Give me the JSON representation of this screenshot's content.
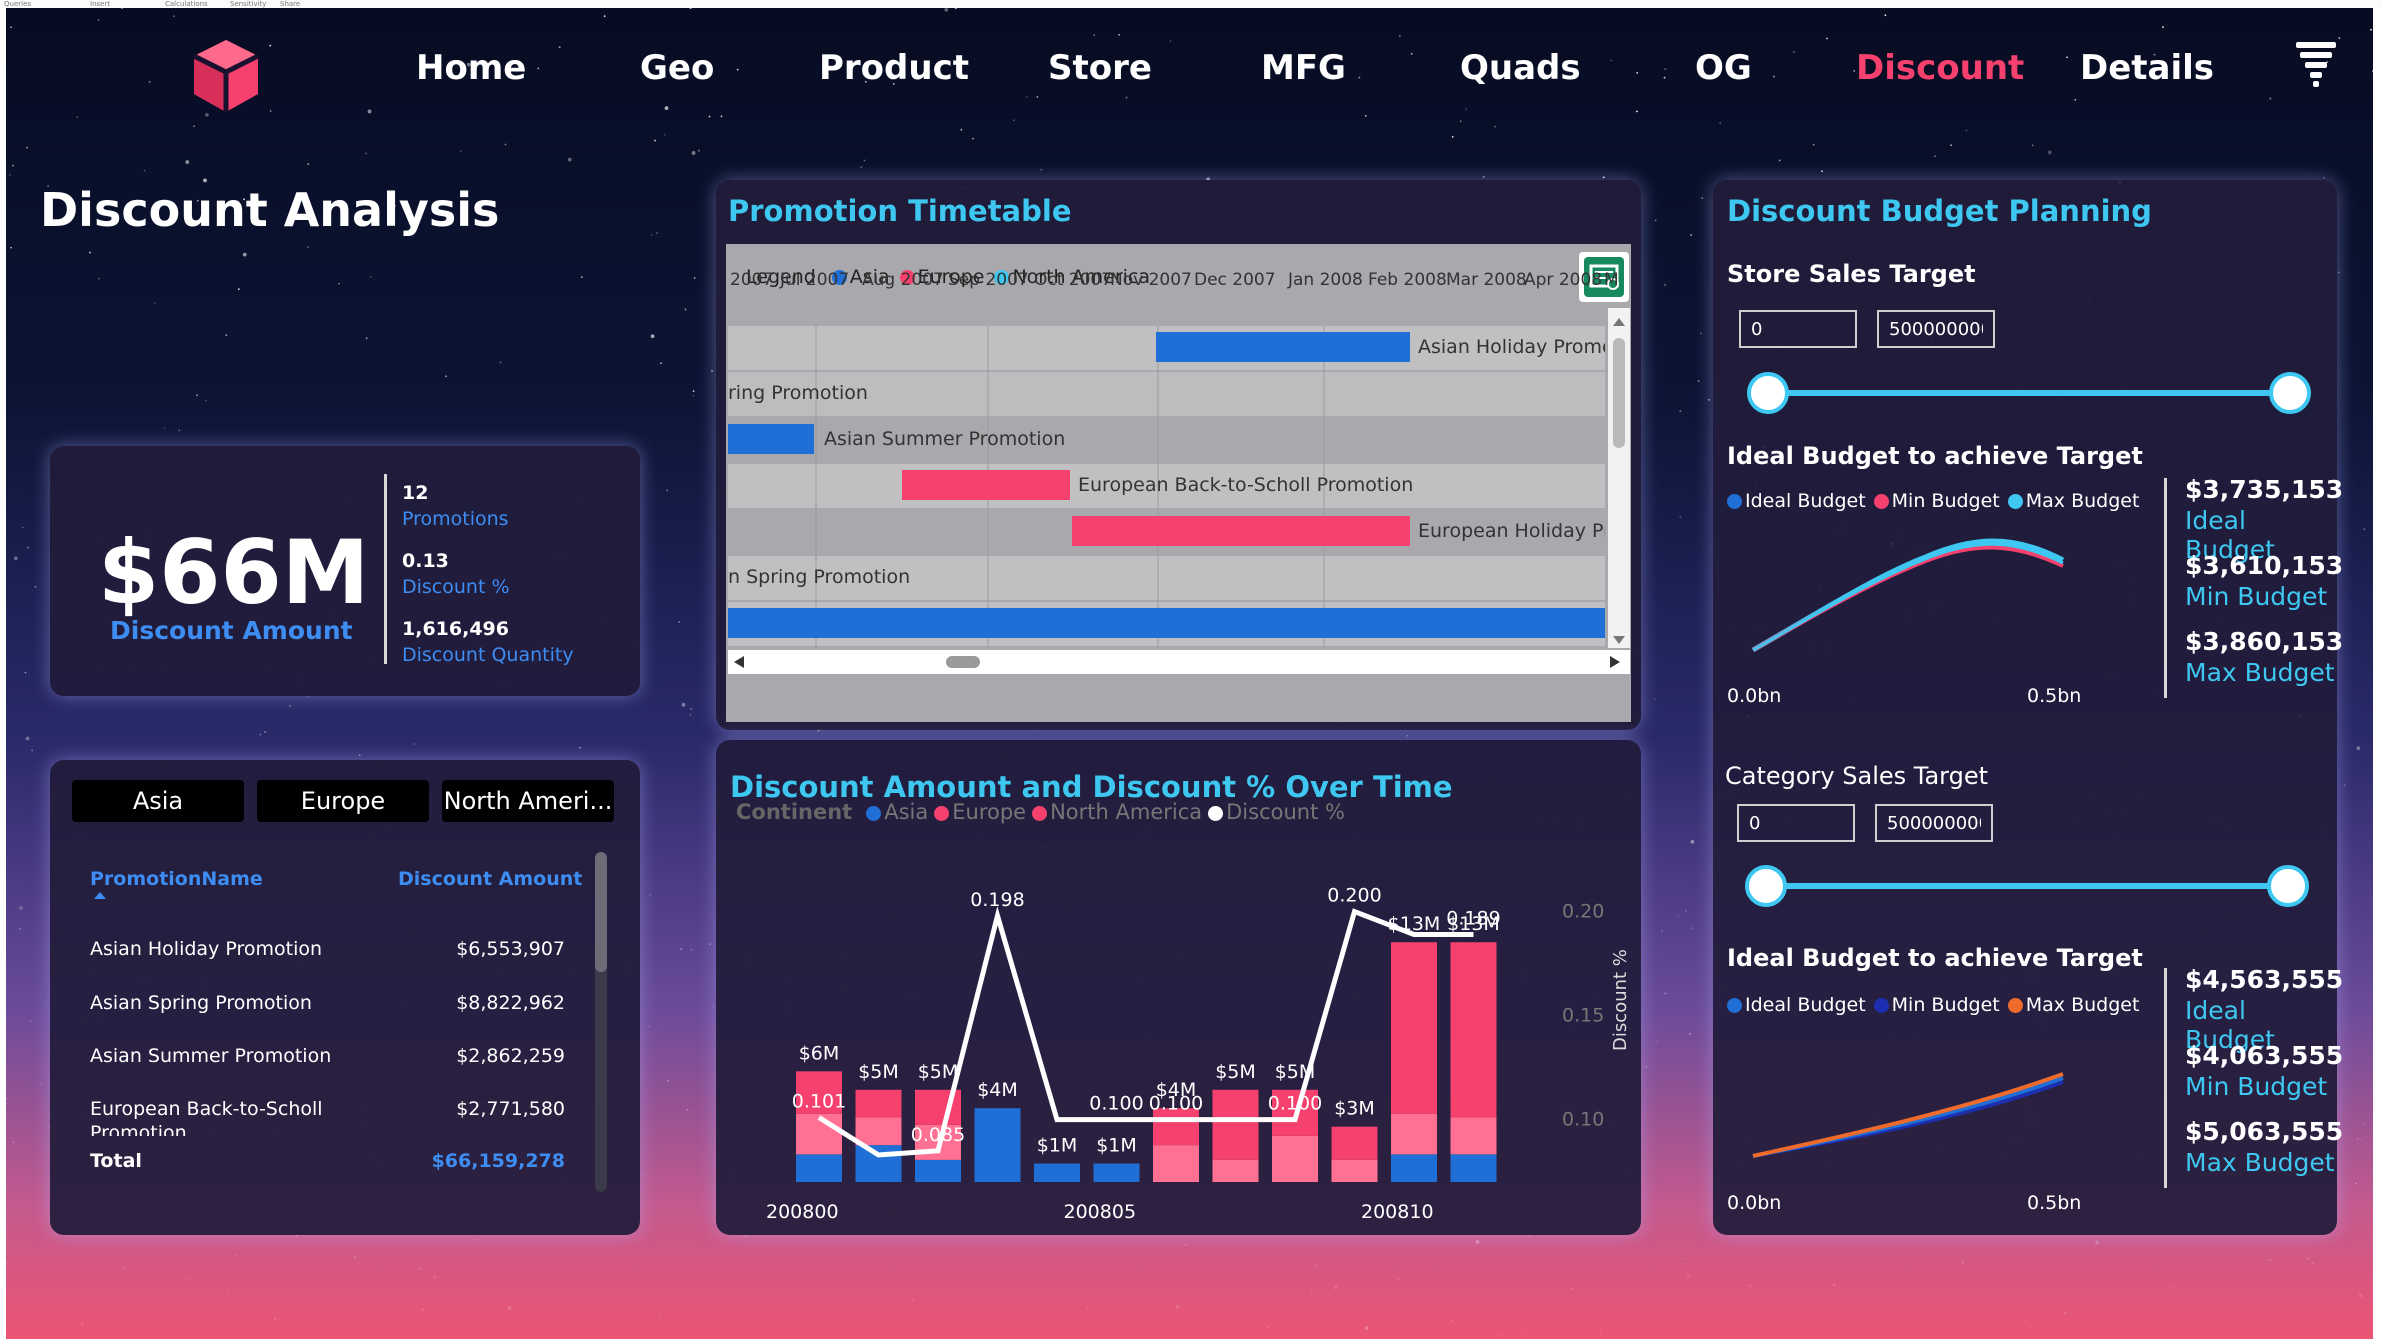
{
  "ribbon": {
    "a": "Queries",
    "b": "Insert",
    "c": "Calculations",
    "d": "Sensitivity",
    "e": "Share"
  },
  "nav": {
    "items": [
      "Home",
      "Geo",
      "Product",
      "Store",
      "MFG",
      "Quads",
      "OG",
      "Discount",
      "Details"
    ],
    "active": "Discount"
  },
  "page_title": "Discount Analysis",
  "kpi": {
    "amount": "$66M",
    "amount_label": "Discount Amount",
    "promotions_value": "12",
    "promotions_label": "Promotions",
    "discount_pct_value": "0.13",
    "discount_pct_label": "Discount %",
    "quantity_value": "1,616,496",
    "quantity_label": "Discount Quantity"
  },
  "slicer": [
    "Asia",
    "Europe",
    "North Ameri..."
  ],
  "table": {
    "col1": "PromotionName",
    "col2": "Discount Amount",
    "rows": [
      {
        "name": "Asian Holiday Promotion",
        "amount": "$6,553,907"
      },
      {
        "name": "Asian Spring Promotion",
        "amount": "$8,822,962"
      },
      {
        "name": "Asian Summer Promotion",
        "amount": "$2,862,259"
      },
      {
        "name": "European Back-to-Scholl",
        "name2": "Promotion",
        "amount": "$2,771,580"
      }
    ],
    "total_label": "Total",
    "total_value": "$66,159,278"
  },
  "timetable": {
    "title": "Promotion Timetable",
    "legend_title": "Legend",
    "legend": [
      {
        "name": "Asia",
        "color": "#1f6fd6"
      },
      {
        "name": "Europe",
        "color": "#f6416e"
      },
      {
        "name": "North America",
        "color": "#3ec7f0"
      }
    ],
    "months": [
      "2007",
      "Jul 2007",
      "Aug 2007",
      "Sep 2007",
      "Oct 2007",
      "Nov 2007",
      "Dec 2007",
      "Jan 2008",
      "Feb 2008",
      "Mar 2008",
      "Apr 2008",
      "M"
    ],
    "rows": [
      {
        "label": "Asian Holiday Promo",
        "color": "#1f6fd6"
      },
      {
        "label": "ring Promotion",
        "color": ""
      },
      {
        "label": "Asian Summer Promotion",
        "color": "#1f6fd6"
      },
      {
        "label": "European Back-to-Scholl Promotion",
        "color": "#f6416e"
      },
      {
        "label": "European Holiday Pr",
        "color": "#f6416e"
      },
      {
        "label": "n Spring Promotion",
        "color": ""
      },
      {
        "label": "",
        "color": "#1f6fd6"
      }
    ]
  },
  "combo": {
    "title": "Discount Amount and Discount % Over Time",
    "legend_title": "Continent",
    "legend": [
      {
        "name": "Asia",
        "color": "#1f6fd6"
      },
      {
        "name": "Europe",
        "color": "#f6416e"
      },
      {
        "name": "North America",
        "color": "#f6416e"
      },
      {
        "name": "Discount %",
        "color": "#ffffff"
      }
    ],
    "y2_title": "Discount %"
  },
  "budget": {
    "title": "Discount Budget Planning",
    "store": {
      "heading": "Store Sales Target",
      "min_input": "0",
      "max_input": "500000000",
      "chart_heading": "Ideal Budget to achieve Target",
      "legend": [
        {
          "name": "Ideal Budget",
          "color": "#1f6fd6"
        },
        {
          "name": "Min Budget",
          "color": "#f6416e"
        },
        {
          "name": "Max Budget",
          "color": "#3ec7f0"
        }
      ],
      "x_left": "0.0bn",
      "x_right": "0.5bn",
      "values": [
        {
          "v": "$3,735,153",
          "l": "Ideal Budget"
        },
        {
          "v": "$3,610,153",
          "l": "Min Budget"
        },
        {
          "v": "$3,860,153",
          "l": "Max Budget"
        }
      ]
    },
    "category": {
      "heading": "Category Sales Target",
      "min_input": "0",
      "max_input": "500000000",
      "chart_heading": "Ideal Budget to achieve Target",
      "legend": [
        {
          "name": "Ideal Budget",
          "color": "#1f6fd6"
        },
        {
          "name": "Min Budget",
          "color": "#1b2fb0"
        },
        {
          "name": "Max Budget",
          "color": "#ef6b2c"
        }
      ],
      "x_left": "0.0bn",
      "x_right": "0.5bn",
      "values": [
        {
          "v": "$4,563,555",
          "l": "Ideal Budget"
        },
        {
          "v": "$4,063,555",
          "l": "Min Budget"
        },
        {
          "v": "$5,063,555",
          "l": "Max Budget"
        }
      ]
    }
  },
  "chart_data": {
    "type": "bar",
    "title": "Discount Amount and Discount % Over Time",
    "series_note": "",
    "x_ticks": [
      "200800",
      "200805",
      "200810"
    ],
    "y2_ticks": [
      "0.10",
      "0.15",
      "0.20"
    ],
    "y2lim": [
      0.07,
      0.22
    ],
    "ylim": [
      0,
      18
    ],
    "bars": [
      {
        "total_label": "$6M",
        "asia": 1.5,
        "europe": 2.2,
        "na": 2.3
      },
      {
        "total_label": "$5M",
        "asia": 2.0,
        "europe": 1.5,
        "na": 1.5
      },
      {
        "total_label": "$5M",
        "asia": 1.2,
        "europe": 1.9,
        "na": 1.9
      },
      {
        "total_label": "$4M",
        "asia": 4.0,
        "europe": 0,
        "na": 0
      },
      {
        "total_label": "$1M",
        "asia": 1.0,
        "europe": 0,
        "na": 0
      },
      {
        "total_label": "$1M",
        "asia": 1.0,
        "europe": 0,
        "na": 0
      },
      {
        "total_label": "$4M",
        "asia": 0,
        "europe": 2.0,
        "na": 2.0
      },
      {
        "total_label": "$5M",
        "asia": 0,
        "europe": 1.2,
        "na": 3.8
      },
      {
        "total_label": "$5M",
        "asia": 0,
        "europe": 2.5,
        "na": 2.5
      },
      {
        "total_label": "$3M",
        "asia": 0,
        "europe": 1.2,
        "na": 1.8
      },
      {
        "total_label": "$13M",
        "asia": 1.5,
        "europe": 2.2,
        "na": 9.3
      },
      {
        "total_label": "$13M",
        "asia": 1.5,
        "europe": 2.0,
        "na": 9.5
      }
    ],
    "line": [
      0.101,
      0.083,
      0.085,
      0.198,
      0.1,
      0.1,
      0.1,
      0.1,
      0.1,
      0.2,
      0.189,
      0.189
    ],
    "line_labels": [
      {
        "i": 0,
        "text": "0.101"
      },
      {
        "i": 2,
        "text": "0.085"
      },
      {
        "i": 3,
        "text": "0.198"
      },
      {
        "i": 5,
        "text": "0.100"
      },
      {
        "i": 6,
        "text": "0.100"
      },
      {
        "i": 8,
        "text": "0.100"
      },
      {
        "i": 9,
        "text": "0.200"
      },
      {
        "i": 11,
        "text": "0.189"
      }
    ]
  }
}
